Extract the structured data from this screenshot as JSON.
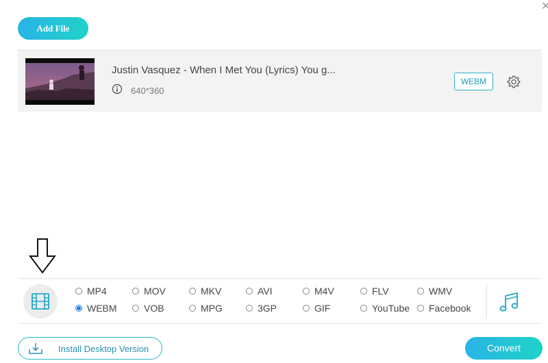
{
  "toolbar": {
    "add_file_label": "Add File"
  },
  "file": {
    "name": "Justin Vasquez - When I Met You (Lyrics) You g...",
    "resolution": "640*360",
    "format_badge": "WEBM"
  },
  "formats": {
    "row1": [
      "MP4",
      "MOV",
      "MKV",
      "AVI",
      "M4V",
      "FLV",
      "WMV"
    ],
    "row2": [
      "WEBM",
      "VOB",
      "MPG",
      "3GP",
      "GIF",
      "YouTube",
      "Facebook"
    ],
    "selected": "WEBM"
  },
  "footer": {
    "install_label": "Install Desktop Version",
    "convert_label": "Convert"
  },
  "colors": {
    "accent_start": "#2ab3e6",
    "accent_end": "#1fd3c8",
    "radio_selected": "#1d7fd6"
  }
}
